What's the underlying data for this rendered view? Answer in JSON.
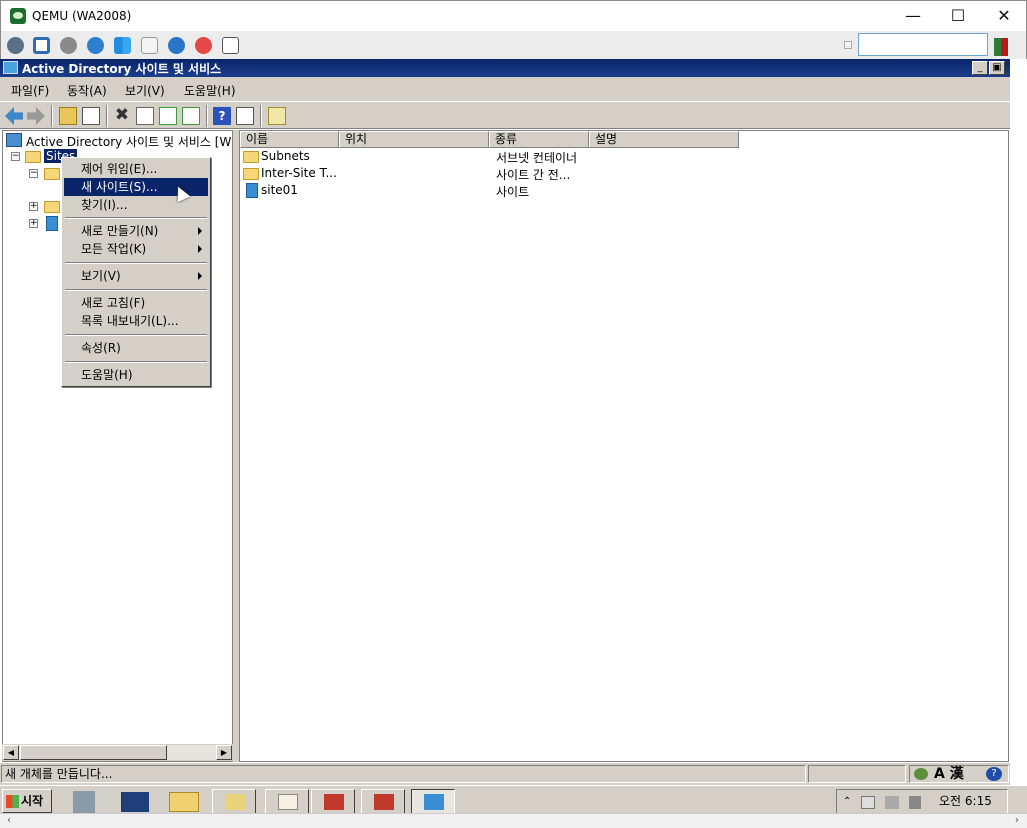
{
  "host": {
    "title": "QEMU (WA2008)",
    "minimize": "—",
    "maximize": "☐",
    "close": "✕",
    "search_value": ""
  },
  "mmc": {
    "title": "Active Directory 사이트 및 서비스",
    "menu": [
      "파일(F)",
      "동작(A)",
      "보기(V)",
      "도움말(H)"
    ]
  },
  "tree": {
    "root_label": "Active Directory 사이트 및 서비스 [W",
    "sites_label": "Sites"
  },
  "list": {
    "columns": [
      "이름",
      "위치",
      "종류",
      "설명"
    ],
    "rows": [
      {
        "name": "Subnets",
        "location": "",
        "type": "서브넷 컨테이너",
        "desc": "",
        "icon": "folder-icon"
      },
      {
        "name": "Inter-Site T...",
        "location": "",
        "type": "사이트 간 전...",
        "desc": "",
        "icon": "folder-icon"
      },
      {
        "name": "site01",
        "location": "",
        "type": "사이트",
        "desc": "",
        "icon": "site-icon"
      }
    ]
  },
  "context_menu": {
    "items": [
      {
        "label": "제어 위임(E)...",
        "submenu": false
      },
      {
        "label": "새 사이트(S)...",
        "submenu": false,
        "selected": true
      },
      {
        "label": "찾기(I)...",
        "submenu": false
      },
      {
        "label": "새로 만들기(N)",
        "submenu": true
      },
      {
        "label": "모든 작업(K)",
        "submenu": true
      },
      {
        "label": "보기(V)",
        "submenu": true
      },
      {
        "label": "새로 고침(F)",
        "submenu": false
      },
      {
        "label": "목록 내보내기(L)...",
        "submenu": false
      },
      {
        "label": "속성(R)",
        "submenu": false
      },
      {
        "label": "도움말(H)",
        "submenu": false
      }
    ]
  },
  "status": {
    "text": "새 개체를 만듭니다...",
    "ime": "A 漢"
  },
  "taskbar": {
    "start_label": "시작",
    "clock_line1": "오전 6:15"
  },
  "colors": {
    "title_bar": "#0a246a",
    "chrome": "#d4d0c8",
    "selection": "#0a246a"
  }
}
